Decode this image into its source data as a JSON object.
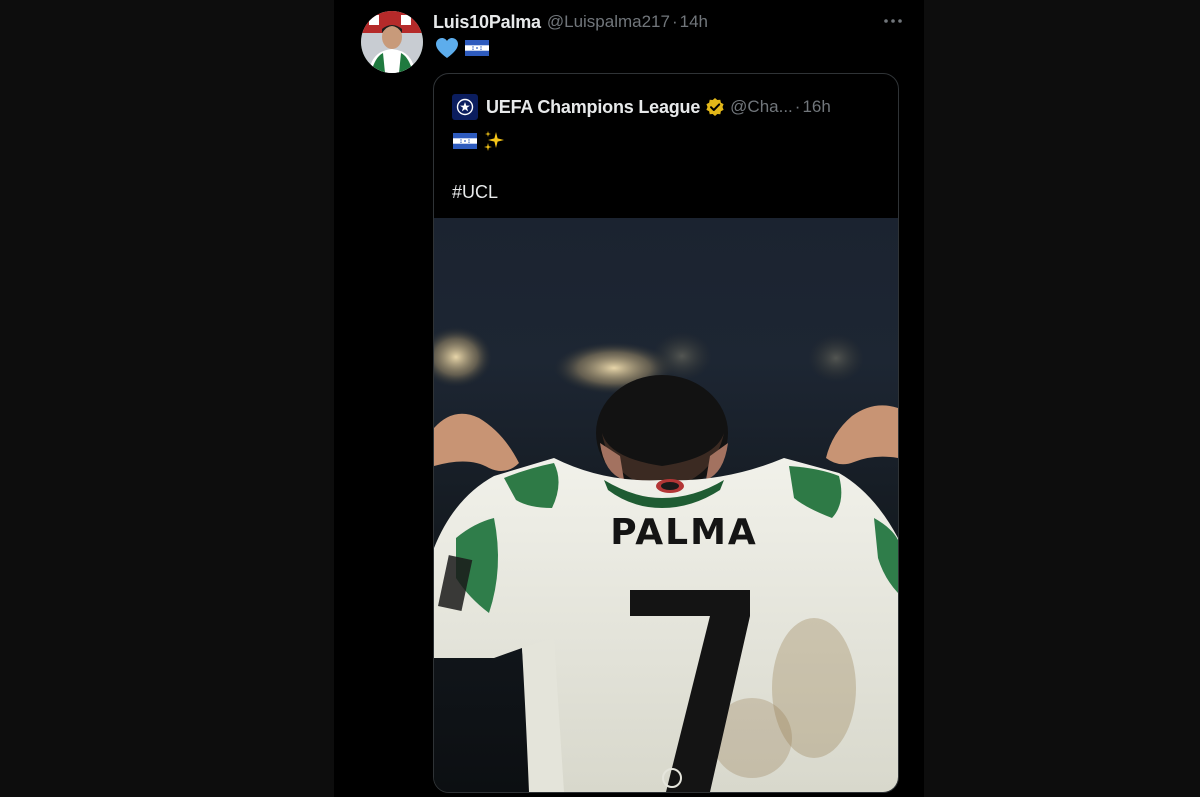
{
  "tweet": {
    "author_name": "Luis10Palma",
    "handle": "@Luispalma217",
    "separator": "·",
    "time": "14h",
    "emojis": [
      "light-blue-heart",
      "honduras-flag"
    ]
  },
  "quoted_tweet": {
    "author_name": "UEFA Champions League",
    "verified": true,
    "handle": "@Cha...",
    "separator": "·",
    "time": "16h",
    "emojis": [
      "honduras-flag",
      "sparkles"
    ],
    "hashtag": "#UCL",
    "photo": {
      "jersey_name": "PALMA",
      "jersey_number": "7"
    }
  },
  "colors": {
    "background": "#000000",
    "border": "#2f3336",
    "text_primary": "#e7e9ea",
    "text_secondary": "#71767b",
    "verified_gold": "#e2b719"
  }
}
